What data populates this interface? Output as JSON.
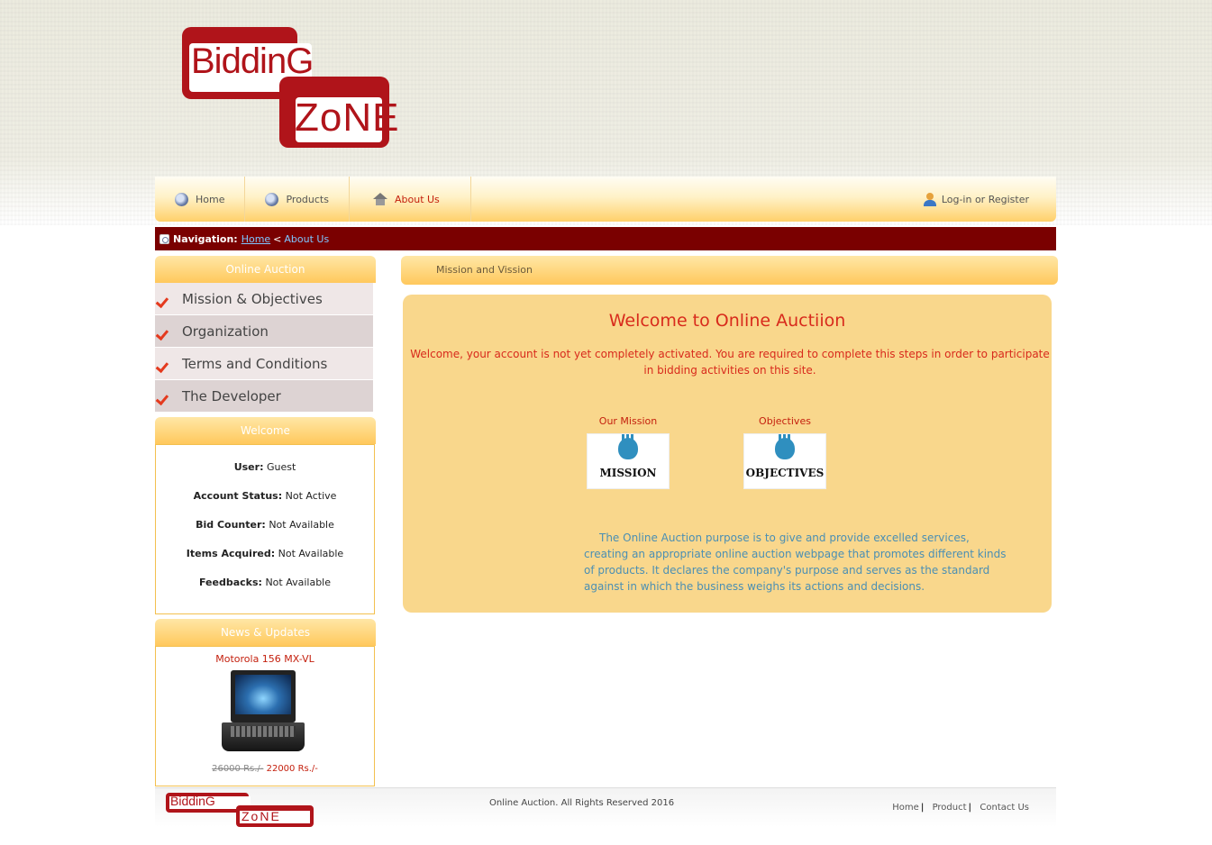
{
  "logo": {
    "line1": "BiddinG",
    "line2": "ZoNE",
    "alt": "Bidding Zone"
  },
  "nav": {
    "items": [
      {
        "label": "Home",
        "icon": "globe-icon"
      },
      {
        "label": "Products",
        "icon": "globe-icon"
      },
      {
        "label": "About Us",
        "icon": "house-icon"
      }
    ],
    "login": "Log-in or Register"
  },
  "breadcrumb": {
    "prefix": "Navigation:",
    "home": "Home",
    "sep": "<",
    "current": "About Us"
  },
  "sidebar": {
    "menu_title": "Online Auction",
    "menu": [
      {
        "label": "Mission & Objectives"
      },
      {
        "label": "Organization"
      },
      {
        "label": "Terms and Conditions"
      },
      {
        "label": "The Developer"
      }
    ],
    "welcome_title": "Welcome",
    "welcome": [
      {
        "key": "User:",
        "value": "Guest"
      },
      {
        "key": "Account Status:",
        "value": "Not Active"
      },
      {
        "key": "Bid Counter:",
        "value": "Not Available"
      },
      {
        "key": "Items Acquired:",
        "value": "Not Available"
      },
      {
        "key": "Feedbacks:",
        "value": "Not Available"
      }
    ],
    "news_title": "News & Updates",
    "news": {
      "product": "Motorola 156 MX-VL",
      "old_price": "26000 Rs./-",
      "new_price": "22000 Rs./-"
    }
  },
  "main": {
    "header": "Mission and Vission",
    "title": "Welcome to Online Auctiion",
    "notice": "Welcome, your account is not yet completely activated. You are required to complete this steps in order to participate in bidding activities on this site.",
    "cards": [
      {
        "label": "Our Mission",
        "caption": "MISSION"
      },
      {
        "label": "Objectives",
        "caption": "OBJECTIVES"
      }
    ],
    "text": "The Online Auction purpose is to give and provide excelled services, creating an appropriate online auction webpage that promotes different kinds of products. It declares the company's purpose and serves as the standard against in which the business weighs its actions and decisions."
  },
  "footer": {
    "copyright": "Online Auction. All Rights Reserved 2016",
    "links": [
      {
        "label": "Home"
      },
      {
        "label": "Product"
      },
      {
        "label": "Contact Us"
      }
    ],
    "link_sep": "|"
  },
  "colors": {
    "brand": "#b0141a",
    "breadcrumb_bg": "#7a0000",
    "panel_bg": "#f9d78c",
    "accent_red": "#d82a1c",
    "text_blue": "#4b8fb3"
  }
}
